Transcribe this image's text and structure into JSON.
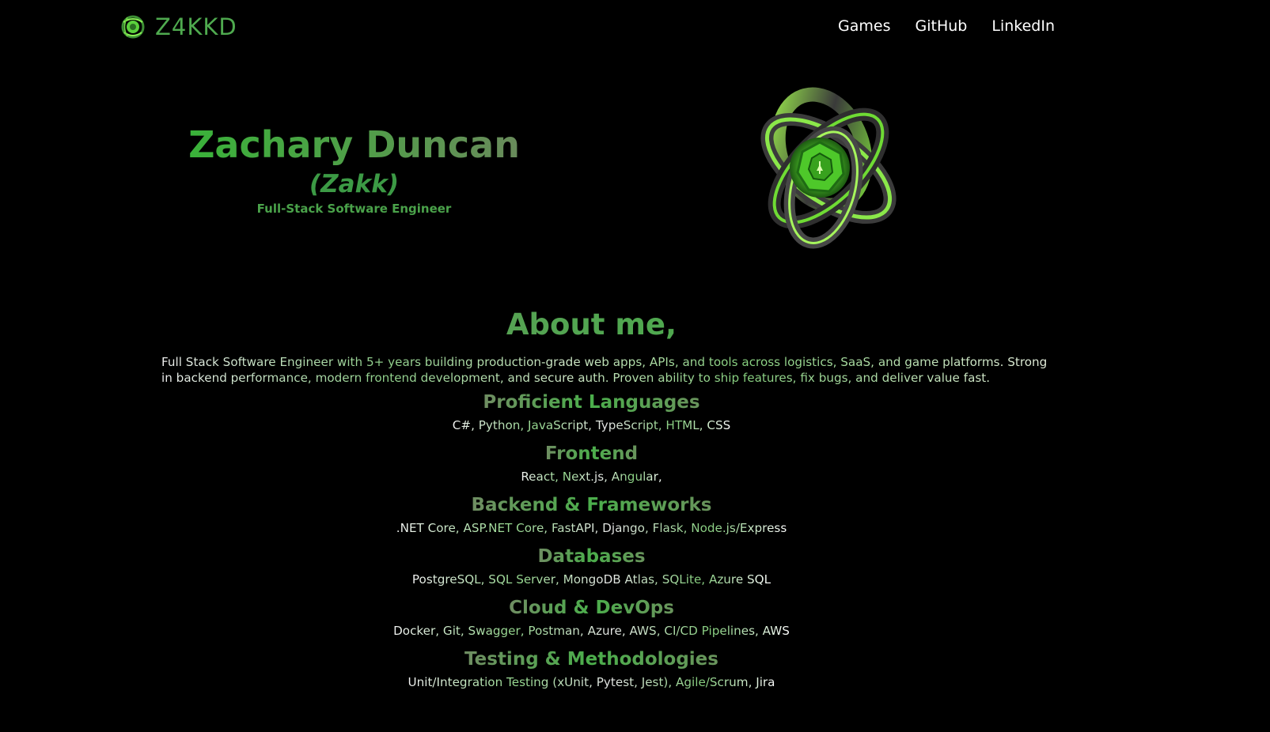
{
  "nav": {
    "brand": "Z4KKD",
    "brand_icon": "green-knot-logo-icon",
    "links": [
      "Games",
      "GitHub",
      "LinkedIn"
    ]
  },
  "hero": {
    "name": "Zachary Duncan",
    "nickname": "(Zakk)",
    "role": "Full-Stack Software Engineer",
    "image": "green-torus-knot-art"
  },
  "about": {
    "title": "About me,",
    "text": "Full Stack Software Engineer with 5+ years building production-grade web apps, APIs, and tools across logistics, SaaS, and game platforms. Strong in backend performance, modern frontend development, and secure auth. Proven ability to ship features, fix bugs, and deliver value fast."
  },
  "skills": [
    {
      "heading": "Proficient Languages",
      "items": "C#, Python, JavaScript, TypeScript, HTML, CSS"
    },
    {
      "heading": "Frontend",
      "items": "React, Next.js, Angular,"
    },
    {
      "heading": "Backend & Frameworks",
      "items": ".NET Core, ASP.NET Core, FastAPI, Django, Flask, Node.js/Express"
    },
    {
      "heading": "Databases",
      "items": "PostgreSQL, SQL Server, MongoDB Atlas, SQLite, Azure SQL"
    },
    {
      "heading": "Cloud & DevOps",
      "items": "Docker, Git, Swagger, Postman, Azure, AWS, CI/CD Pipelines, AWS"
    },
    {
      "heading": "Testing & Methodologies",
      "items": "Unit/Integration Testing (xUnit, Pytest, Jest), Agile/Scrum, Jira"
    }
  ],
  "colors": {
    "background": "#000000",
    "accent": "#4faa4f",
    "nav_text": "#ffffff"
  }
}
